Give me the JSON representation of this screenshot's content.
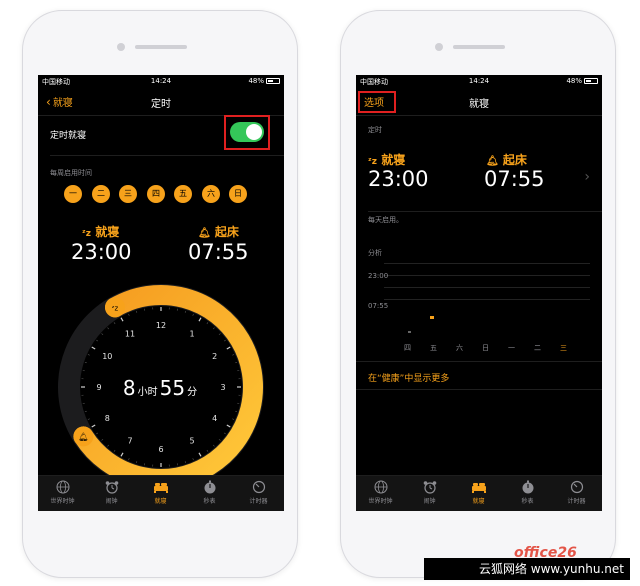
{
  "status": {
    "carrier": "中国移动",
    "time": "14:24",
    "battery": "48%"
  },
  "left": {
    "back": "就寝",
    "title": "定时",
    "toggle_label": "定时就寝",
    "toggle_on": true,
    "days_title": "每周启用时间",
    "days": [
      "一",
      "二",
      "三",
      "四",
      "五",
      "六",
      "日"
    ],
    "bedtime_label": "就寝",
    "bedtime_value": "23:00",
    "wake_label": "起床",
    "wake_value": "07:55",
    "duration_hours": "8",
    "duration_hours_unit": "小时",
    "duration_minutes": "55",
    "duration_minutes_unit": "分",
    "clock_numbers": [
      "12",
      "1",
      "2",
      "3",
      "4",
      "5",
      "6",
      "7",
      "8",
      "9",
      "10",
      "11"
    ]
  },
  "right": {
    "options": "选项",
    "title": "就寝",
    "section_title": "定时",
    "bedtime_label": "就寝",
    "bedtime_value": "23:00",
    "wake_label": "起床",
    "wake_value": "07:55",
    "everyday": "每天启用。",
    "analysis_title": "分析",
    "chart_ticks": [
      "23:00",
      "07:55"
    ],
    "chart_days": [
      "四",
      "五",
      "六",
      "日",
      "一",
      "二",
      "三"
    ],
    "health_link": "在“健康”中显示更多"
  },
  "tabs": [
    {
      "label": "世界时钟",
      "icon": "globe-icon"
    },
    {
      "label": "闹钟",
      "icon": "alarm-clock-icon"
    },
    {
      "label": "就寝",
      "icon": "bed-icon"
    },
    {
      "label": "秒表",
      "icon": "stopwatch-icon"
    },
    {
      "label": "计时器",
      "icon": "timer-icon"
    }
  ],
  "active_tab": 2,
  "watermark": {
    "site": "云狐网络 www.yunhu.net",
    "brand": "office26"
  },
  "colors": {
    "accent": "#f7a21b",
    "toggle": "#34c759",
    "highlight_box": "#e02020"
  }
}
